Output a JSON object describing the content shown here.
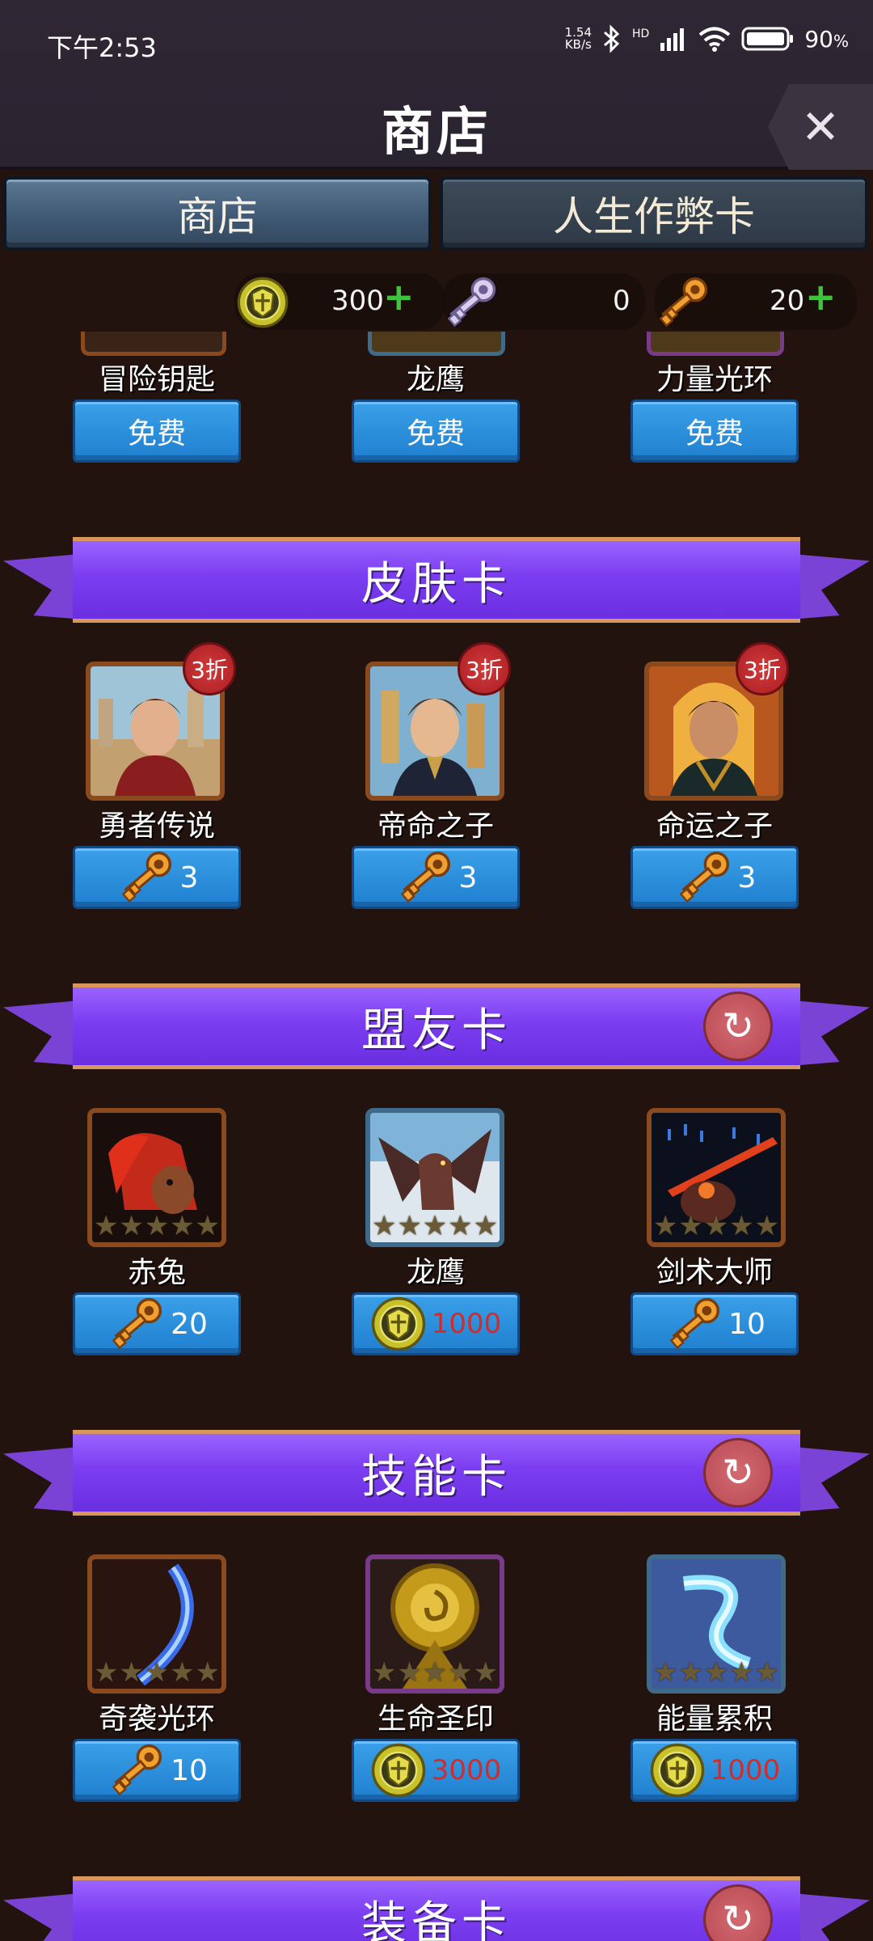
{
  "status_bar": {
    "time": "下午2:53",
    "net_speed_value": "1.54",
    "net_speed_unit": "KB/s",
    "hd": "HD",
    "battery": "90",
    "battery_unit": "%"
  },
  "header": {
    "title": "商店",
    "close_label": "✕"
  },
  "tabs": [
    {
      "label": "商店",
      "active": true
    },
    {
      "label": "人生作弊卡",
      "active": false
    }
  ],
  "currencies": [
    {
      "icon": "gold-shield-coin-icon",
      "value": "300",
      "has_plus": true
    },
    {
      "icon": "silver-key-icon",
      "value": "0",
      "has_plus": false
    },
    {
      "icon": "gold-key-icon",
      "value": "20",
      "has_plus": true
    }
  ],
  "top_section": {
    "items": [
      {
        "name": "冒险钥匙",
        "price": "免费"
      },
      {
        "name": "龙鹰",
        "price": "免费"
      },
      {
        "name": "力量光环",
        "price": "免费"
      }
    ]
  },
  "sections": [
    {
      "title": "皮肤卡",
      "has_refresh": false,
      "items": [
        {
          "name": "勇者传说",
          "badge": "3折",
          "price_icon": "gold-key-icon",
          "price": "3"
        },
        {
          "name": "帝命之子",
          "badge": "3折",
          "price_icon": "gold-key-icon",
          "price": "3"
        },
        {
          "name": "命运之子",
          "badge": "3折",
          "price_icon": "gold-key-icon",
          "price": "3"
        }
      ]
    },
    {
      "title": "盟友卡",
      "has_refresh": true,
      "items": [
        {
          "name": "赤兔",
          "price_icon": "gold-key-icon",
          "price": "20"
        },
        {
          "name": "龙鹰",
          "price_icon": "gold-shield-coin-icon",
          "price": "1000",
          "price_insufficient": true
        },
        {
          "name": "剑术大师",
          "price_icon": "gold-key-icon",
          "price": "10"
        }
      ]
    },
    {
      "title": "技能卡",
      "has_refresh": true,
      "items": [
        {
          "name": "奇袭光环",
          "price_icon": "gold-key-icon",
          "price": "10"
        },
        {
          "name": "生命圣印",
          "price_icon": "gold-shield-coin-icon",
          "price": "3000",
          "price_insufficient": true
        },
        {
          "name": "能量累积",
          "price_icon": "gold-shield-coin-icon",
          "price": "1000",
          "price_insufficient": true
        }
      ]
    },
    {
      "title": "装备卡",
      "has_refresh": true,
      "items": []
    }
  ],
  "colors": {
    "ribbon": "#7b3df0",
    "price_button": "#1f7fcf",
    "insufficient": "#d32a2a",
    "discount_badge": "#c12a2e"
  }
}
